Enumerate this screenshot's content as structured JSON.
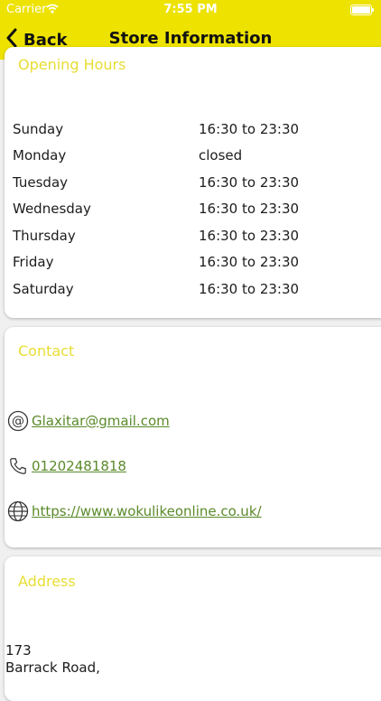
{
  "status_bar": {
    "carrier": "Carrier",
    "time": "7:55 PM"
  },
  "nav": {
    "back_label": "Back",
    "title": "Store Information"
  },
  "opening_hours": {
    "title": "Opening Hours",
    "rows": [
      {
        "day": "Sunday",
        "hours": "16:30 to 23:30"
      },
      {
        "day": "Monday",
        "hours": "closed"
      },
      {
        "day": "Tuesday",
        "hours": "16:30 to 23:30"
      },
      {
        "day": "Wednesday",
        "hours": "16:30 to 23:30"
      },
      {
        "day": "Thursday",
        "hours": "16:30 to 23:30"
      },
      {
        "day": "Friday",
        "hours": "16:30 to 23:30"
      },
      {
        "day": "Saturday",
        "hours": "16:30 to 23:30"
      }
    ]
  },
  "contact": {
    "title": "Contact",
    "email": "Glaxitar@gmail.com",
    "phone": "01202481818",
    "website": "https://www.wokulikeonline.co.uk/",
    "icons": {
      "email": "at-icon",
      "phone": "phone-icon",
      "website": "globe-icon"
    }
  },
  "address": {
    "title": "Address",
    "lines": [
      "173",
      "Barrack Road,"
    ]
  },
  "colors": {
    "header": "#ede200",
    "section_title": "#e8dd33",
    "link": "#5a8a2a"
  }
}
